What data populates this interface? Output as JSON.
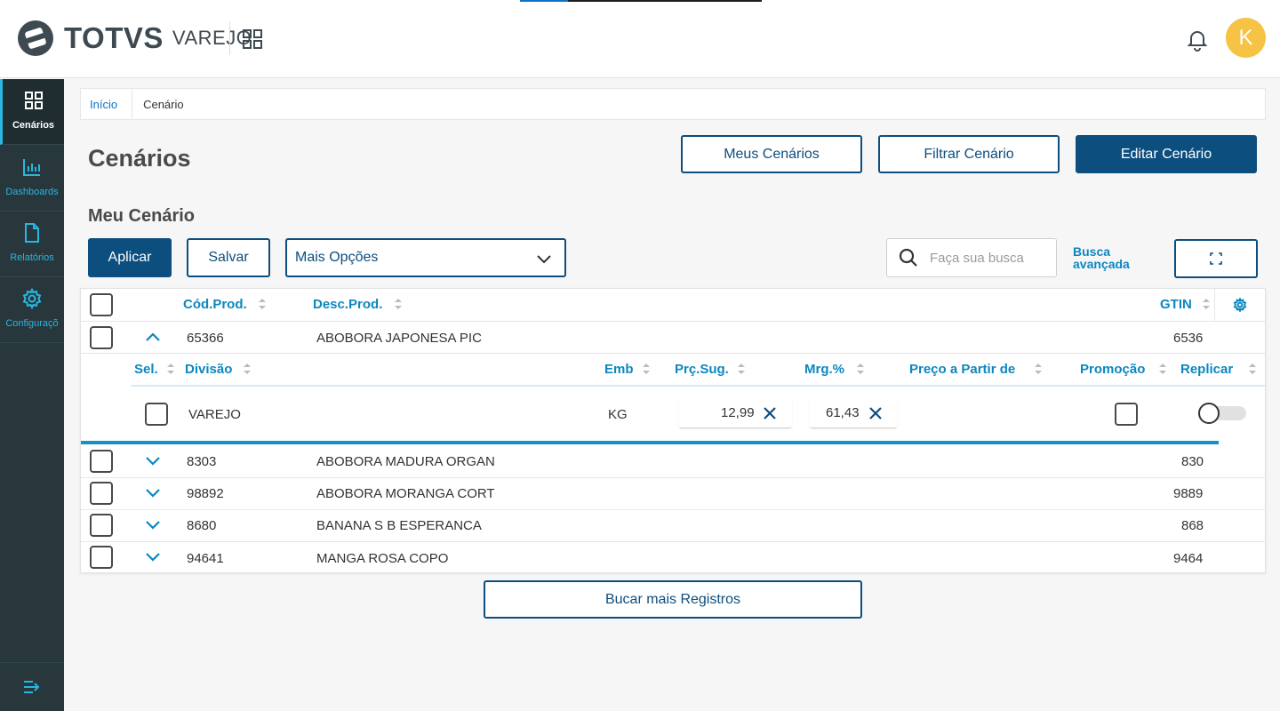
{
  "header": {
    "brand": "TOTVS",
    "product": "VAREJO",
    "avatar_initial": "K",
    "icons": [
      "totvs-logo-icon",
      "apps-grid-icon",
      "bell-icon"
    ]
  },
  "sidebar": {
    "items": [
      {
        "label": "Cenários",
        "icon": "grid-icon",
        "active": true
      },
      {
        "label": "Dashboards",
        "icon": "bar-chart-icon",
        "active": false
      },
      {
        "label": "Relatórios",
        "icon": "document-icon",
        "active": false
      },
      {
        "label": "Configuraçõ",
        "icon": "gear-icon",
        "active": false
      }
    ],
    "collapse_icon": "collapse-menu-icon"
  },
  "breadcrumb": {
    "home": "Início",
    "current": "Cenário"
  },
  "page": {
    "title": "Cenários"
  },
  "actions": {
    "meus_cenarios": "Meus Cenários",
    "filtrar_cenario": "Filtrar Cenário",
    "editar_cenario": "Editar Cenário"
  },
  "scenario": {
    "section_title": "Meu Cenário",
    "apply_label": "Aplicar",
    "save_label": "Salvar",
    "options_selected": "Mais Opções",
    "search_placeholder": "Faça sua busca",
    "advanced_search_line1": "Busca",
    "advanced_search_line2": "avançada",
    "fetch_more": "Bucar mais Registros"
  },
  "table": {
    "columns": {
      "cod": "Cód.Prod.",
      "desc": "Desc.Prod.",
      "gtin": "GTIN"
    },
    "rows": [
      {
        "cod": "65366",
        "desc": "ABOBORA JAPONESA PIC",
        "gtin": "6536",
        "expanded": true
      },
      {
        "cod": "8303",
        "desc": "ABOBORA MADURA ORGAN",
        "gtin": "830",
        "expanded": false
      },
      {
        "cod": "98892",
        "desc": "ABOBORA MORANGA CORT",
        "gtin": "9889",
        "expanded": false
      },
      {
        "cod": "8680",
        "desc": "BANANA S B ESPERANCA",
        "gtin": "868",
        "expanded": false
      },
      {
        "cod": "94641",
        "desc": "MANGA ROSA COPO",
        "gtin": "9464",
        "expanded": false
      }
    ],
    "detail": {
      "columns": {
        "sel": "Sel.",
        "divisao": "Divisão",
        "emb": "Emb",
        "prc": "Prç.Sug.",
        "mrg": "Mrg.%",
        "preco_partir": "Preço a Partir de",
        "promocao": "Promoção",
        "replicar": "Replicar"
      },
      "row": {
        "divisao": "VAREJO",
        "emb": "KG",
        "prc": "12,99",
        "mrg": "61,43",
        "promocao": false,
        "replicar": false
      }
    }
  },
  "colors": {
    "primary": "#0c4e7e",
    "accent": "#0c87c0",
    "sidebar": "#27373c",
    "avatar": "#f6c345"
  }
}
